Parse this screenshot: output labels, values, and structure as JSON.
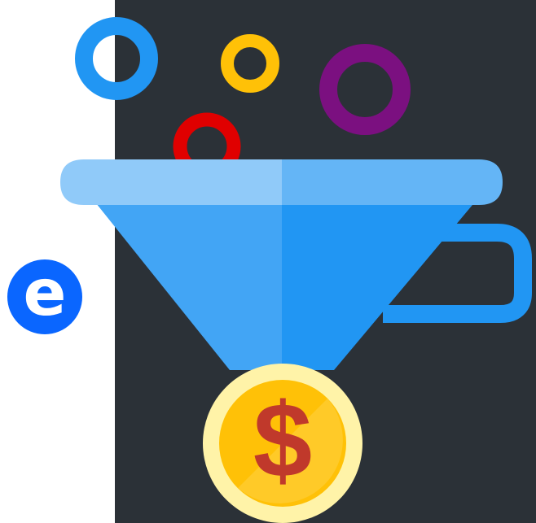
{
  "colors": {
    "background": "#ffffff",
    "panel": "#2b3137",
    "funnel_light": "#64b5f6",
    "funnel_lighter": "#90caf9",
    "funnel_body": "#42a5f5",
    "funnel_dark": "#2196f3",
    "ring_blue": "#2196f3",
    "ring_yellow": "#ffc107",
    "ring_purple": "#7b1080",
    "ring_red": "#e00000",
    "coin_outer": "#fff3a8",
    "coin_inner": "#ffc107",
    "coin_shade": "#ffca28",
    "dollar": "#c0392b",
    "logo_blue": "#0a66ff"
  },
  "logo": {
    "letter": "e"
  },
  "coin": {
    "symbol": "$"
  },
  "icons": [
    "ring-icon",
    "funnel-icon",
    "coin-icon",
    "dollar-icon",
    "logo-icon"
  ]
}
